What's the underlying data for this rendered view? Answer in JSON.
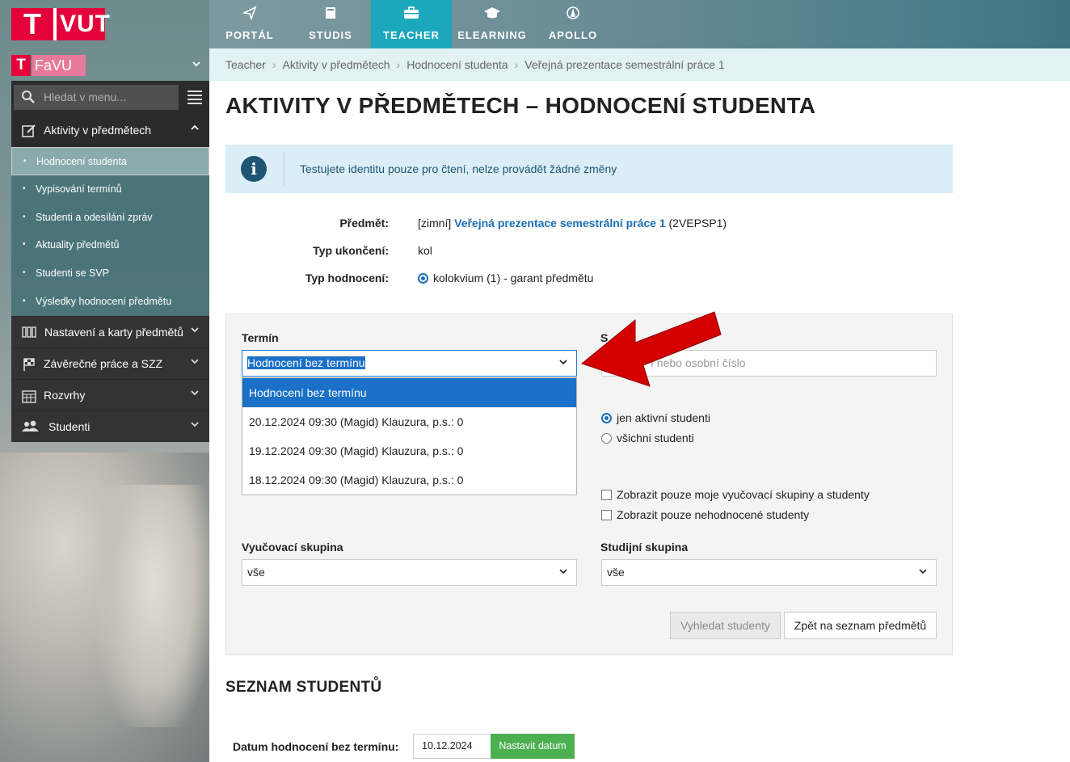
{
  "logo": {
    "letter": "T",
    "text": "VUT"
  },
  "topnav": [
    {
      "label": "PORTÁL",
      "icon": "paper-plane-icon"
    },
    {
      "label": "STUDIS",
      "icon": "book-icon"
    },
    {
      "label": "TEACHER",
      "icon": "briefcase-icon",
      "active": true
    },
    {
      "label": "ELEARNING",
      "icon": "graduation-cap-icon"
    },
    {
      "label": "APOLLO",
      "icon": "apollo-icon"
    }
  ],
  "faculty": {
    "letter": "T",
    "name": "FaVU"
  },
  "sidebar": {
    "search_placeholder": "Hledat v menu...",
    "active_section": "Aktivity v předmětech",
    "subitems": [
      "Hodnocení studenta",
      "Vypisování termínů",
      "Studenti a odesílání zpráv",
      "Aktuality předmětů",
      "Studenti se SVP",
      "Výsledky hodnocení předmětu"
    ],
    "sections": [
      "Nastavení a karty předmětů",
      "Závěrečné práce a SZZ",
      "Rozvrhy",
      "Studenti"
    ]
  },
  "breadcrumb": [
    "Teacher",
    "Aktivity v předmětech",
    "Hodnocení studenta",
    "Veřejná prezentace semestrální práce 1"
  ],
  "page_title": "AKTIVITY V PŘEDMĚTECH – HODNOCENÍ STUDENTA",
  "info_message": "Testujete identitu pouze pro čtení, nelze provádět žádné změny",
  "details": {
    "subject_label": "Předmět:",
    "subject_prefix": "[zimní]",
    "subject_name": "Veřejná prezentace semestrální práce 1",
    "subject_code": "(2VEPSP1)",
    "completion_label": "Typ ukončení:",
    "completion_value": "kol",
    "evaluation_label": "Typ hodnocení:",
    "evaluation_value": "kolokvium (1) - garant předmětu"
  },
  "filter": {
    "term_label": "Termín",
    "term_selected": "Hodnocení bez termínu",
    "term_options": [
      "Hodnocení bez termínu",
      "20.12.2024 09:30 (Magid) Klauzura, p.s.: 0",
      "19.12.2024 09:30 (Magid) Klauzura, p.s.: 0",
      "18.12.2024 09:30 (Magid) Klauzura, p.s.: 0"
    ],
    "student_label_partial": "S",
    "student_placeholder_partial": "í nebo osobní číslo",
    "radio_active": "jen aktivní studenti",
    "radio_all": "všichni studenti",
    "check_my_groups": "Zobrazit pouze moje vyučovací skupiny a studenty",
    "check_unrated": "Zobrazit pouze nehodnocené studenty",
    "teaching_group_label": "Vyučovací skupina",
    "teaching_group_value": "vše",
    "study_group_label": "Studijní skupina",
    "study_group_value": "vše",
    "search_button": "Vyhledat studenty",
    "back_button": "Zpět na seznam předmětů"
  },
  "students": {
    "title": "SEZNAM STUDENTŮ",
    "date_label": "Datum hodnocení bez termínu:",
    "date_value": "10.12.2024",
    "set_date_button": "Nastavit datum"
  },
  "colors": {
    "accent": "#1ba8bd",
    "brand": "#e4003a",
    "link": "#1c6fb5",
    "arrow": "#d40000",
    "success": "#4caf50"
  }
}
